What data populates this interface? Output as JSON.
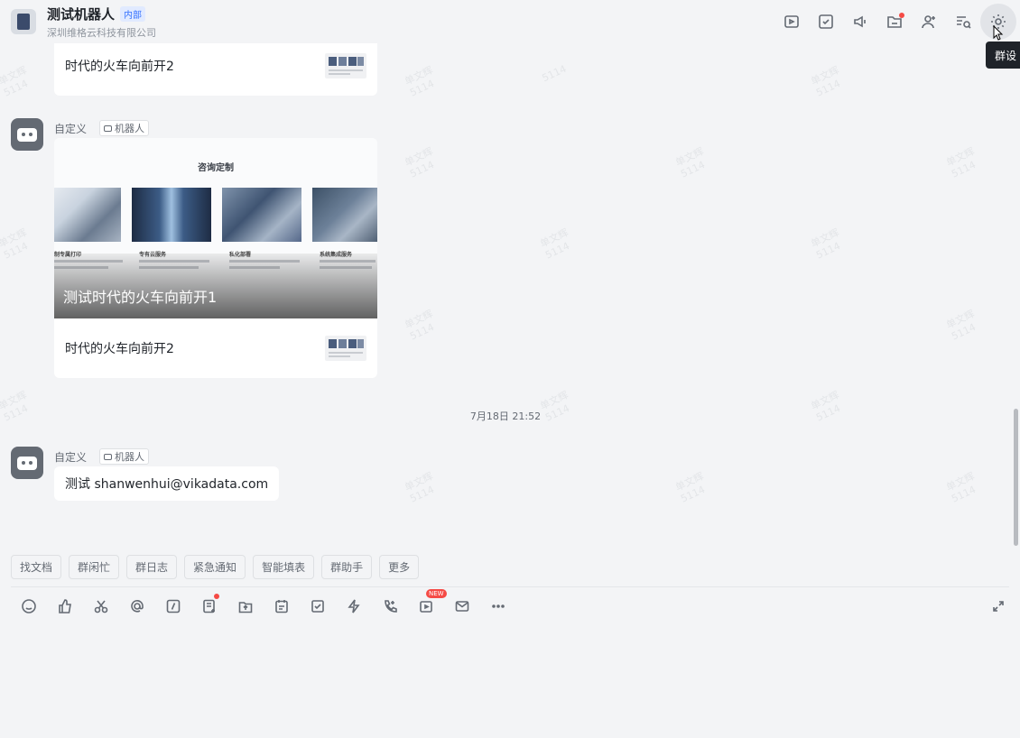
{
  "header": {
    "title": "测试机器人",
    "tag": "内部",
    "subtitle": "深圳维格云科技有限公司",
    "tooltip": "群设",
    "icons": [
      "video-meeting-icon",
      "task-icon",
      "announcement-icon",
      "folder-icon",
      "add-member-icon",
      "search-history-icon",
      "settings-icon"
    ]
  },
  "messages": {
    "top_card_link": "时代的火车向前开2",
    "bot_name": "自定义",
    "bot_badge": "机器人",
    "card": {
      "banner_title": "咨询定制",
      "captions": [
        "制专属打印",
        "专有云服务",
        "私化部署",
        "系统集成服务"
      ],
      "headline": "测试时代的火车向前开1",
      "link": "时代的火车向前开2"
    },
    "timestamp": "7月18日 21:52",
    "bot_name_2": "自定义",
    "bot_badge_2": "机器人",
    "text": "测试 shanwenhui@vikadata.com"
  },
  "watermark": {
    "line1": "单文辉",
    "line2": "5114"
  },
  "quick_actions": [
    "找文档",
    "群闲忙",
    "群日志",
    "紧急通知",
    "智能填表",
    "群助手",
    "更多"
  ],
  "toolbar": {
    "new_badge": "NEW",
    "icons": [
      "emoji-icon",
      "thumbs-up-icon",
      "scissors-icon",
      "mention-icon",
      "slash-command-icon",
      "doc-add-icon",
      "upload-icon",
      "calendar-icon",
      "todo-icon",
      "lightning-icon",
      "call-icon",
      "video-icon",
      "mail-icon",
      "more-icon"
    ]
  },
  "colors": {
    "accent": "#3370ff",
    "badge_red": "#f54a45",
    "background": "#f3f4f6"
  }
}
